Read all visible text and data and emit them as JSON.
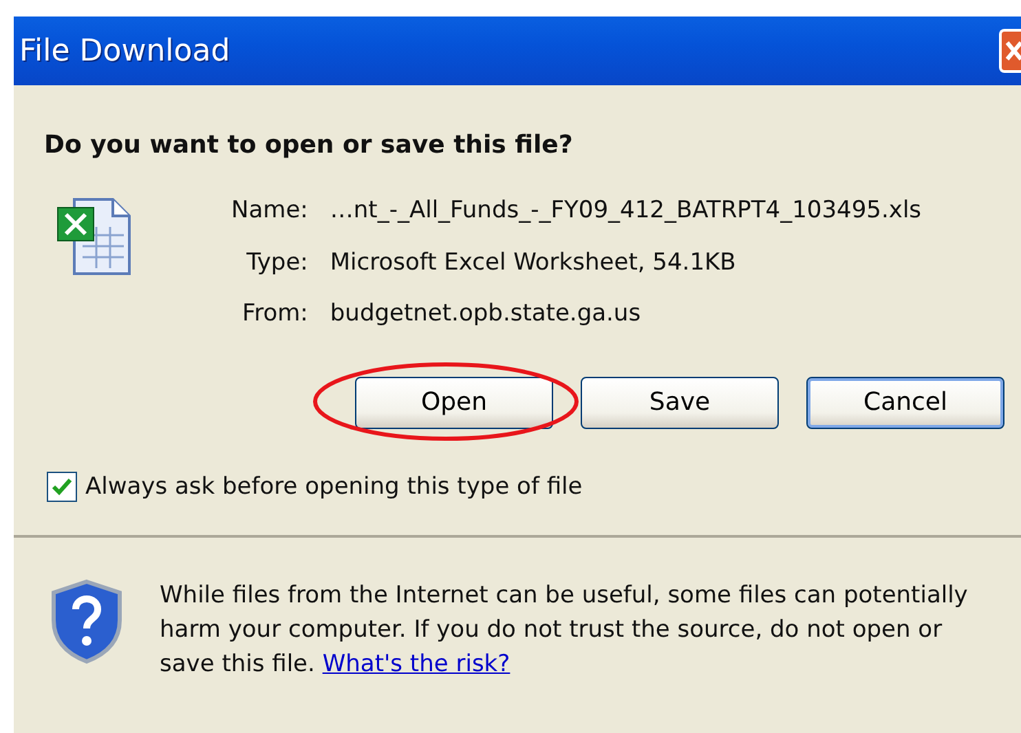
{
  "window": {
    "title": "File Download"
  },
  "question": "Do you want to open or save this file?",
  "details": [
    {
      "label": "Name:",
      "value": "…nt_-_All_Funds_-_FY09_412_BATRPT4_103495.xls"
    },
    {
      "label": "Type:",
      "value": "Microsoft Excel Worksheet, 54.1KB"
    },
    {
      "label": "From:",
      "value": "budgetnet.opb.state.ga.us"
    }
  ],
  "buttons": [
    {
      "label": "Open",
      "focused": false,
      "circled": true
    },
    {
      "label": "Save",
      "focused": false,
      "circled": false
    },
    {
      "label": "Cancel",
      "focused": true,
      "circled": false
    }
  ],
  "always_ask": {
    "label": "Always ask before opening this type of file",
    "checked": true
  },
  "warning": {
    "text": "While files from the Internet can be useful, some files can potentially harm your computer. If you do not trust the source, do not open or save this file.",
    "link": "What's the risk?"
  }
}
